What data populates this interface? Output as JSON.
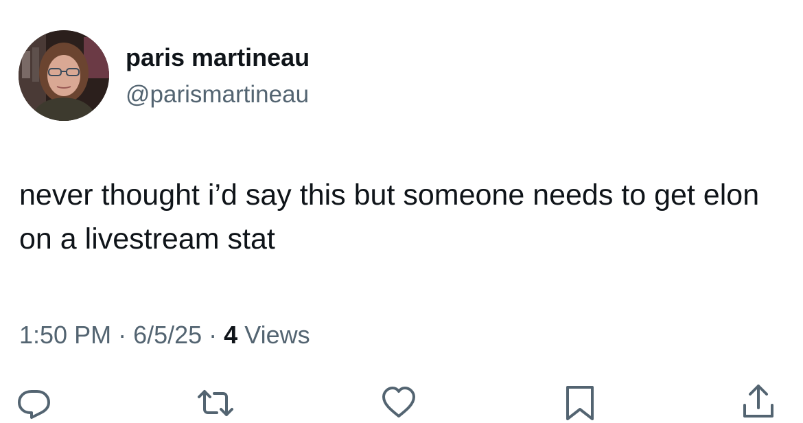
{
  "author": {
    "display_name": "paris martineau",
    "handle": "@parismartineau",
    "avatar_icon": "profile-photo"
  },
  "tweet": {
    "text": "never thought i’d say this but someone needs to get elon on a livestream stat"
  },
  "meta": {
    "time": "1:50 PM",
    "separator": " · ",
    "date": "6/5/25",
    "views_count": "4",
    "views_label": " Views"
  },
  "actions": [
    {
      "icon": "reply-icon"
    },
    {
      "icon": "repost-icon"
    },
    {
      "icon": "like-icon"
    },
    {
      "icon": "bookmark-icon"
    },
    {
      "icon": "share-icon"
    }
  ],
  "colors": {
    "text_primary": "#0f1419",
    "text_secondary": "#536471",
    "background": "#ffffff"
  }
}
